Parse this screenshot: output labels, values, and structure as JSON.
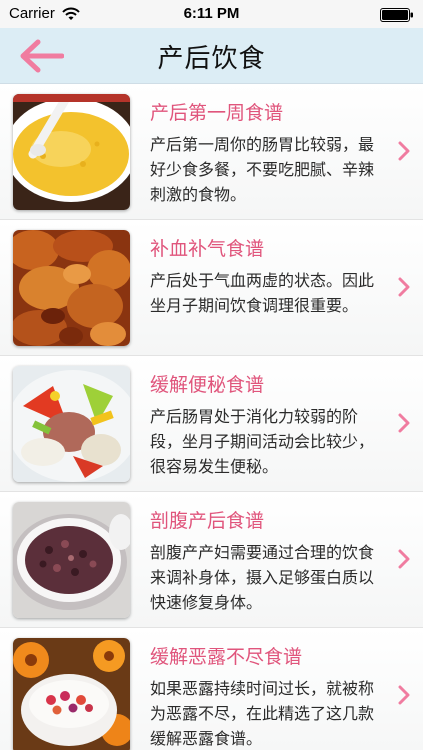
{
  "status_bar": {
    "carrier": "Carrier",
    "time": "6:11 PM",
    "wifi_icon": "wifi-icon",
    "battery_icon": "battery-icon"
  },
  "nav": {
    "title": "产后饮食",
    "back_icon": "arrow-left-icon",
    "accent_color": "#f07ca0",
    "background_color": "#dcedf5"
  },
  "recipes": [
    {
      "title": "产后第一周食谱",
      "description": "产后第一周你的肠胃比较弱，最好少食多餐，不要吃肥腻、辛辣刺激的食物。",
      "image": "millet-porridge-photo"
    },
    {
      "title": "补血补气食谱",
      "description": "产后处于气血两虚的状态。因此坐月子期间饮食调理很重要。",
      "image": "braised-meat-photo"
    },
    {
      "title": "缓解便秘食谱",
      "description": "产后肠胃处于消化力较弱的阶段，坐月子期间活动会比较少，很容易发生便秘。",
      "image": "vegetable-stir-fry-photo"
    },
    {
      "title": "剖腹产后食谱",
      "description": "剖腹产产妇需要通过合理的饮食来调补身体，摄入足够蛋白质以快速修复身体。",
      "image": "red-bean-soup-photo"
    },
    {
      "title": "缓解恶露不尽食谱",
      "description": "如果恶露持续时间过长，就被称为恶露不尽，在此精选了这几款缓解恶露食谱。",
      "image": "flower-dessert-bowl-photo"
    }
  ],
  "colors": {
    "row_title": "#e0557c",
    "chevron": "#f07ca0"
  }
}
